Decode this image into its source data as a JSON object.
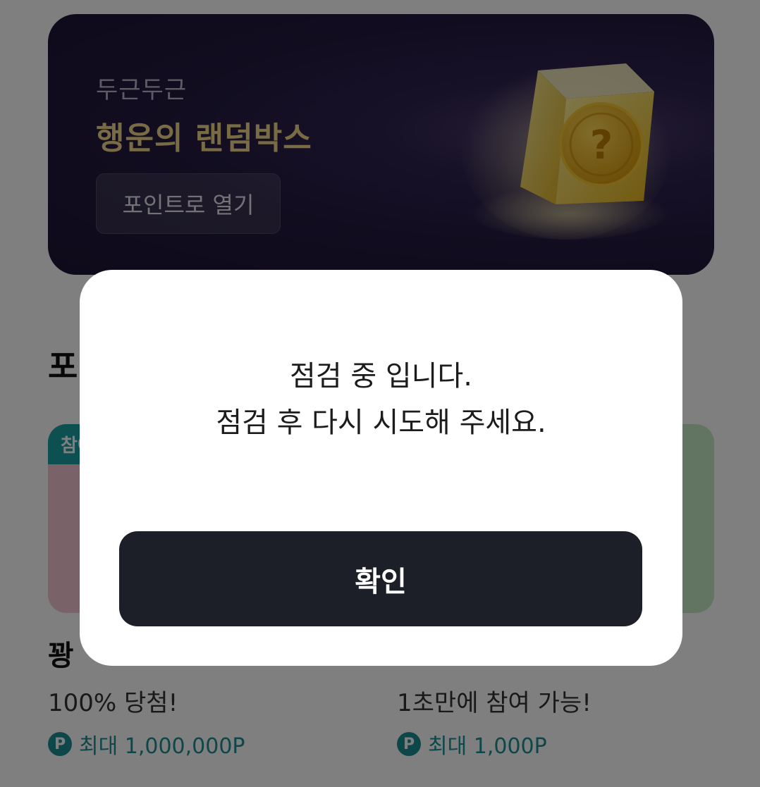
{
  "banner": {
    "subtitle": "두근두근",
    "title": "행운의 랜덤박스",
    "open_button": "포인트로 열기",
    "illustration_icon": "mystery-box-icon",
    "question_mark": "?"
  },
  "section": {
    "title_visible": "포"
  },
  "cards": [
    {
      "badge": "참여",
      "name_visible": "꽝",
      "description": "100% 당첨!",
      "reward_icon": "P",
      "reward": "최대 1,000,000P",
      "color": "#f3c7d0"
    },
    {
      "description": "1초만에 참여 가능!",
      "reward_icon": "P",
      "reward": "최대 1,000P",
      "color": "#c5eac7"
    }
  ],
  "modal": {
    "message_line1": "점검 중 입니다.",
    "message_line2": "점검 후 다시 시도해 주세요.",
    "confirm_button": "확인"
  },
  "colors": {
    "banner_bg": "#231a3f",
    "banner_title": "#f3d98a",
    "accent_teal": "#1b8e93",
    "modal_button": "#1c1f27"
  }
}
